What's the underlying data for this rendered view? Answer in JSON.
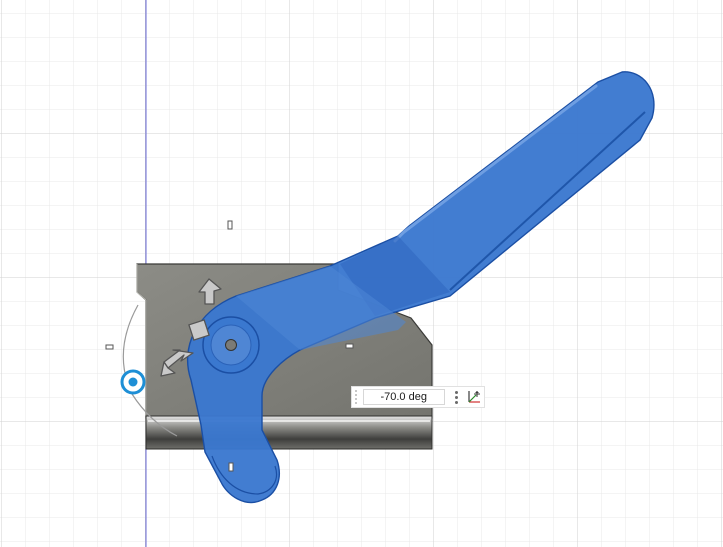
{
  "rotate_manipulator": {
    "angle_value": "-70.0 deg"
  },
  "icons": {
    "rotate_arrow": "curved-arrow-icon",
    "direction_arrow": "arrow-icon",
    "move_handle": "square-handle-icon",
    "menu": "vertical-ellipsis-icon",
    "axis": "axis-triad-icon"
  },
  "colors": {
    "selection_blue": "#3a78cf",
    "body_gray": "#7f7f78",
    "manipulator_blue": "#1e8fd6",
    "origin_axis": "#6b6bd8"
  }
}
